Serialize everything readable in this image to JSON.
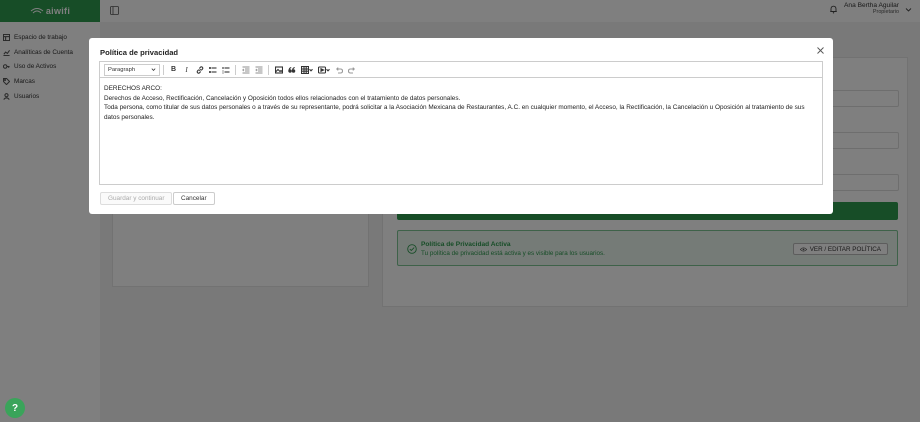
{
  "app": {
    "logo_text": "aiwifi"
  },
  "sidebar": {
    "items": [
      {
        "label": "Espacio de trabajo",
        "icon": "table-icon"
      },
      {
        "label": "Analíticas de Cuenta",
        "icon": "chart-icon"
      },
      {
        "label": "Uso de Activos",
        "icon": "key-icon"
      },
      {
        "label": "Marcas",
        "icon": "tag-icon"
      },
      {
        "label": "Usuarios",
        "icon": "user-icon"
      }
    ]
  },
  "header": {
    "user_name": "Ana Bertha Aguilar",
    "user_role": "Propietario"
  },
  "background": {
    "policy_title": "Política de Privacidad Activa",
    "policy_subtitle": "Tu política de privacidad está activa y es visible para los usuarios.",
    "policy_button": "VER / EDITAR POLÍTICA",
    "accent": "#2e9a4f"
  },
  "modal": {
    "title": "Política de privacidad",
    "toolbar": {
      "block_format": "Paragraph"
    },
    "content": {
      "line1": "DERECHOS ARCO:",
      "line2": "Derechos de Acceso, Rectificación, Cancelación y Oposición todos ellos relacionados con el tratamiento de datos personales.",
      "line3": "Toda persona, como titular de sus datos personales o a través de su representante, podrá solicitar a la Asociación Mexicana de Restaurantes, A.C. en cualquier momento, el Acceso, la Rectificación, la Cancelación u   Oposición al tratamiento de sus datos personales."
    },
    "save_label": "Guardar y continuar",
    "cancel_label": "Cancelar"
  }
}
